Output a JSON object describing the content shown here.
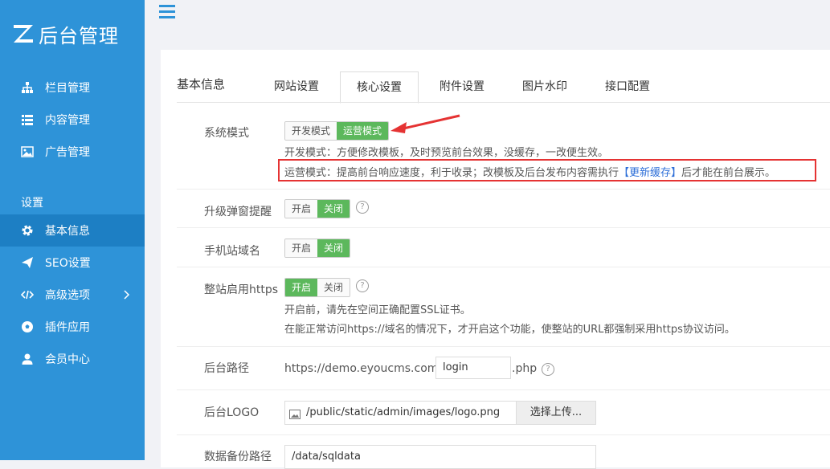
{
  "app": {
    "title": "后台管理"
  },
  "sidebar": {
    "items": [
      {
        "label": "栏目管理",
        "icon": "sitemap-icon"
      },
      {
        "label": "内容管理",
        "icon": "list-icon"
      },
      {
        "label": "广告管理",
        "icon": "image-icon"
      }
    ],
    "section_label": "设置",
    "settings_items": [
      {
        "label": "基本信息",
        "icon": "gear-icon"
      },
      {
        "label": "SEO设置",
        "icon": "paper-plane-icon"
      },
      {
        "label": "高级选项",
        "icon": "code-icon"
      },
      {
        "label": "插件应用",
        "icon": "soccer-ball-icon"
      },
      {
        "label": "会员中心",
        "icon": "user-icon"
      }
    ]
  },
  "panel": {
    "title": "基本信息",
    "tabs": [
      "网站设置",
      "核心设置",
      "附件设置",
      "图片水印",
      "接口配置"
    ],
    "active_tab": "核心设置"
  },
  "form": {
    "system_mode": {
      "label": "系统模式",
      "options": [
        "开发模式",
        "运营模式"
      ],
      "selected": "运营模式",
      "hint_dev": "开发模式：方便修改模板，及时预览前台效果，没缓存，一改便生效。",
      "hint_ops_prefix": "运营模式：提高前台响应速度，利于收录；改模板及后台发布内容需执行",
      "hint_ops_link": "【更新缓存】",
      "hint_ops_suffix": "后才能在前台展示。"
    },
    "upgrade_popup": {
      "label": "升级弹窗提醒",
      "options": [
        "开启",
        "关闭"
      ],
      "selected": "关闭"
    },
    "mobile_domain": {
      "label": "手机站域名",
      "options": [
        "开启",
        "关闭"
      ],
      "selected": "关闭"
    },
    "https": {
      "label": "整站启用https",
      "options": [
        "开启",
        "关闭"
      ],
      "selected": "开启",
      "hint1": "开启前，请先在空间正确配置SSL证书。",
      "hint2": "在能正常访问https://域名的情况下，才开启这个功能，使整站的URL都强制采用https协议访问。"
    },
    "admin_path": {
      "label": "后台路径",
      "prefix": "https://demo.eyoucms.com/",
      "value": "login",
      "suffix": ".php"
    },
    "admin_logo": {
      "label": "后台LOGO",
      "value": "/public/static/admin/images/logo.png",
      "button": "选择上传..."
    },
    "backup_path": {
      "label": "数据备份路径",
      "value": "/data/sqldata"
    }
  },
  "colors": {
    "sidebar": "#2e93d8",
    "sidebar_active": "#1d7fc4",
    "toggle_on": "#5cb85c",
    "highlight_box": "#e53333"
  }
}
